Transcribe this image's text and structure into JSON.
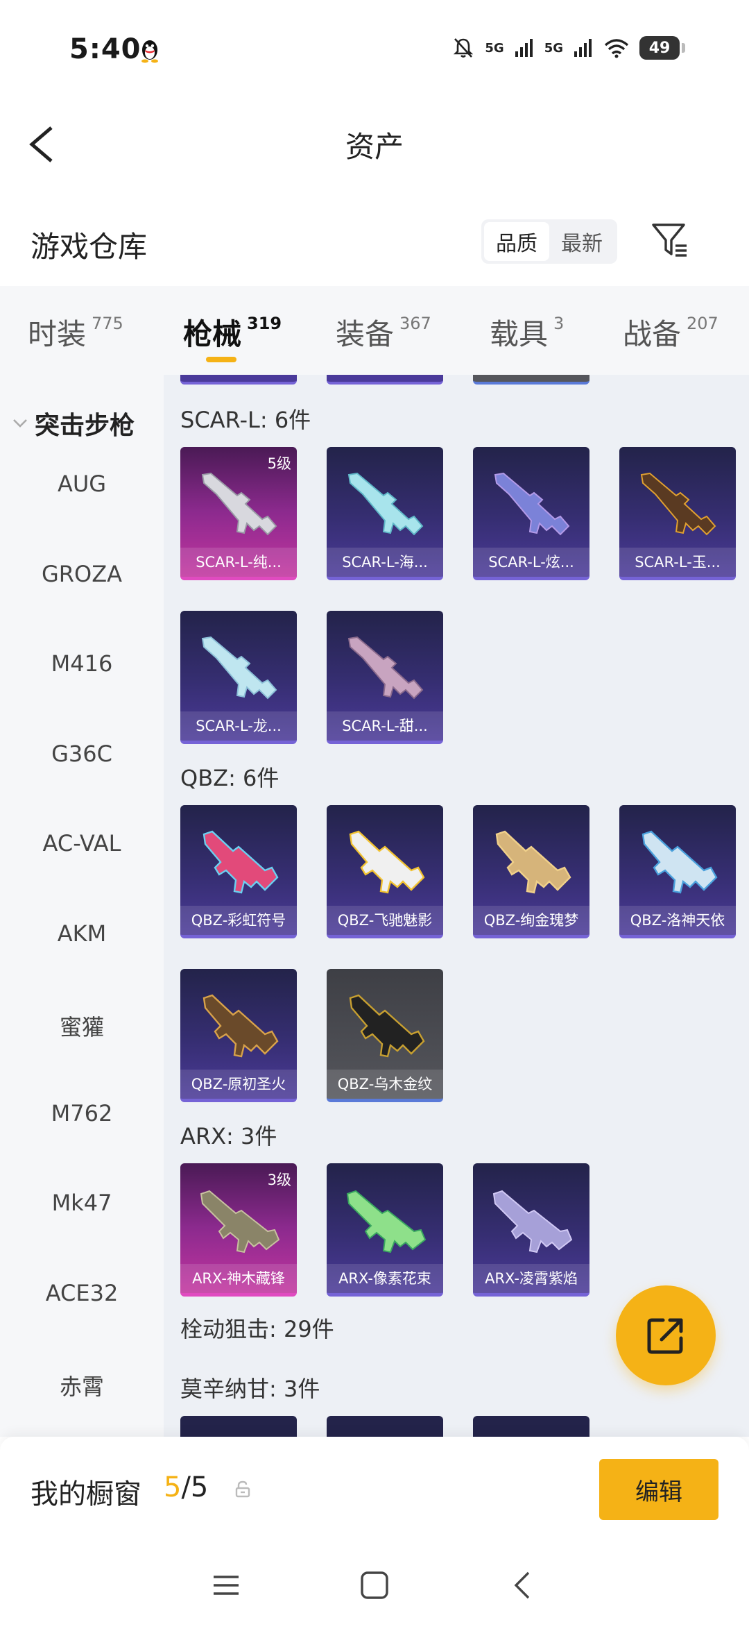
{
  "status": {
    "time": "5:40",
    "network1": "5G",
    "network2": "5G",
    "battery": "49"
  },
  "header": {
    "title": "资产"
  },
  "warehouse": {
    "title": "游戏仓库",
    "sort_options": [
      "品质",
      "最新"
    ]
  },
  "tabs": [
    {
      "label": "时装",
      "count": "775"
    },
    {
      "label": "枪械",
      "count": "319"
    },
    {
      "label": "装备",
      "count": "367"
    },
    {
      "label": "载具",
      "count": "3"
    },
    {
      "label": "战备",
      "count": "207"
    }
  ],
  "sidebar": {
    "category": "突击步枪",
    "items": [
      "AUG",
      "GROZA",
      "M416",
      "G36C",
      "AC-VAL",
      "AKM",
      "蜜獾",
      "M762",
      "Mk47",
      "ACE32",
      "赤霄"
    ]
  },
  "sections": [
    {
      "title": "SCAR-L: 6件",
      "items": [
        {
          "name": "SCAR-L-纯...",
          "level": "5级"
        },
        {
          "name": "SCAR-L-海..."
        },
        {
          "name": "SCAR-L-炫..."
        },
        {
          "name": "SCAR-L-玉..."
        },
        {
          "name": "SCAR-L-龙..."
        },
        {
          "name": "SCAR-L-甜..."
        }
      ]
    },
    {
      "title": "QBZ: 6件",
      "items": [
        {
          "name": "QBZ-彩虹符号"
        },
        {
          "name": "QBZ-飞驰魅影"
        },
        {
          "name": "QBZ-绚金瑰梦"
        },
        {
          "name": "QBZ-洛神天依"
        },
        {
          "name": "QBZ-原初圣火"
        },
        {
          "name": "QBZ-乌木金纹"
        }
      ]
    },
    {
      "title": "ARX: 3件",
      "items": [
        {
          "name": "ARX-神木藏锋",
          "level": "3级"
        },
        {
          "name": "ARX-像素花束"
        },
        {
          "name": "ARX-凌霄紫焰"
        }
      ]
    },
    {
      "title": "栓动狙击: 29件"
    },
    {
      "title": "莫辛纳甘: 3件"
    }
  ],
  "showcase": {
    "label": "我的橱窗",
    "current": "5",
    "total": "/5",
    "edit_label": "编辑"
  },
  "colors": {
    "accent": "#f5b216",
    "card_purple": "#362e72",
    "card_pink": "#c2359f",
    "card_grey": "#55565c"
  },
  "icons": [
    "back-icon",
    "filter-icon",
    "share-icon",
    "lock-icon",
    "menu-icon",
    "home-icon",
    "nav-back-icon"
  ]
}
